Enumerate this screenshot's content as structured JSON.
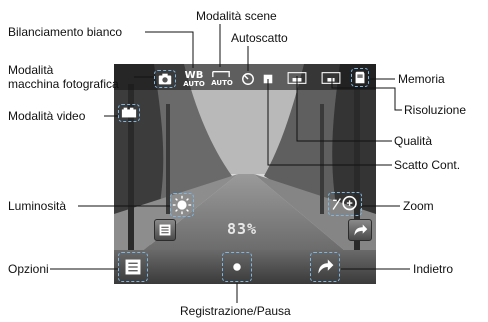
{
  "labels": {
    "white_balance": "Bilanciamento bianco",
    "scene_mode": "Modalità scene",
    "self_timer": "Autoscatto",
    "camera_mode_line1": "Modalità",
    "camera_mode_line2": "macchina fotografica",
    "video_mode": "Modalità video",
    "memory": "Memoria",
    "resolution": "Risoluzione",
    "quality": "Qualità",
    "continuous_shot": "Scatto Cont.",
    "brightness": "Luminosità",
    "zoom": "Zoom",
    "options": "Opzioni",
    "back": "Indietro",
    "record_pause": "Registrazione/Pausa"
  },
  "screen": {
    "wb_top": "WB",
    "wb_bottom": "AUTO",
    "scene_value": "AUTO",
    "brightness_value": "83%",
    "icons": {
      "camera": "camera-icon",
      "video": "video-camera-icon",
      "white_balance": "white-balance-icon",
      "scene": "scene-mode-icon",
      "timer": "timer-icon",
      "continuous": "continuous-shot-icon",
      "quality": "quality-icon",
      "resolution": "resolution-icon",
      "memory": "memory-card-icon",
      "brightness": "sun-icon",
      "zoom": "zoom-icon",
      "options": "list-icon",
      "record": "record-icon",
      "back": "back-arrow-icon"
    }
  },
  "colors": {
    "highlight": "#7fb6e0",
    "leader_line": "#111111"
  }
}
